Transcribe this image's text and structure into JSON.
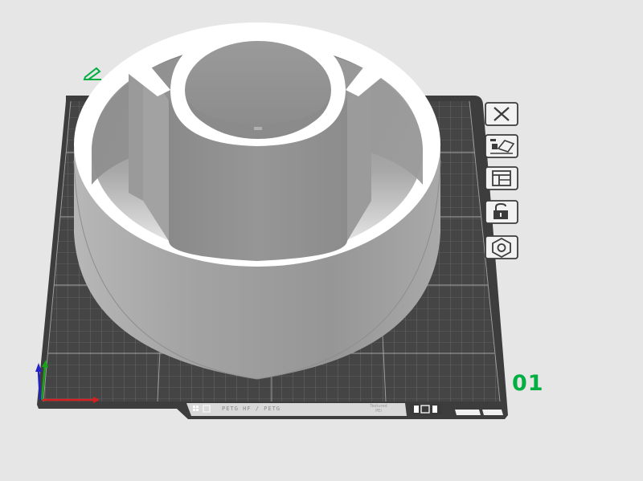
{
  "plate": {
    "number": "01",
    "filament_strip_label": "PETG HF / PETG",
    "smart_label": "Textured PEI"
  },
  "toolbar": {
    "items": [
      {
        "name": "delete-plate-button",
        "icon": "close-x-icon"
      },
      {
        "name": "arrange-plate-button",
        "icon": "auto-arrange-icon"
      },
      {
        "name": "plate-settings-button",
        "icon": "plate-settings-icon"
      },
      {
        "name": "lock-plate-button",
        "icon": "lock-icon"
      },
      {
        "name": "auto-orient-button",
        "icon": "hexagon-icon"
      }
    ]
  },
  "colors": {
    "background": "#e6e6e6",
    "bed": "#3c3c3c",
    "grid_line": "#8c8c8c",
    "model": "#9e9e9e",
    "accent_green": "#00ae42",
    "axis_x": "#d42020",
    "axis_y": "#1aa31a",
    "axis_z": "#2222c8"
  }
}
